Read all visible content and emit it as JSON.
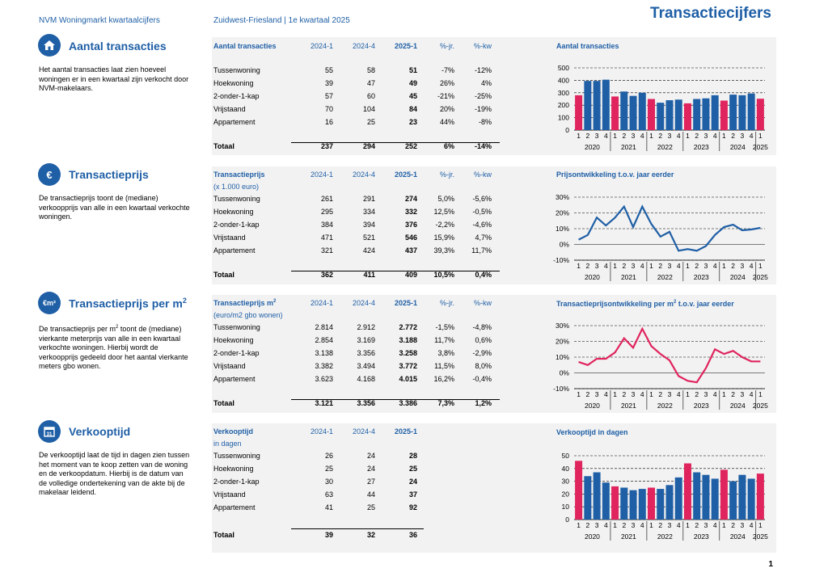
{
  "header": {
    "left": "NVM Woningmarkt kwartaalcijfers",
    "mid": "Zuidwest-Friesland | 1e kwartaal 2025",
    "title": "Transactiecijfers"
  },
  "page_number": "1",
  "colors": {
    "blue": "#1f5fa6",
    "red": "#e0245e",
    "grey_panel": "#f2f2f2"
  },
  "x_axis": {
    "quarters": [
      "1",
      "2",
      "3",
      "4",
      "1",
      "2",
      "3",
      "4",
      "1",
      "2",
      "3",
      "4",
      "1",
      "2",
      "3",
      "4",
      "1",
      "2",
      "3",
      "4",
      "1"
    ],
    "years": [
      "2020",
      "2021",
      "2022",
      "2023",
      "2024",
      "2025"
    ]
  },
  "sections": [
    {
      "icon": "house-icon",
      "title": "Aantal transacties",
      "desc": "Het aantal transacties laat zien hoeveel woningen er in een kwartaal zijn verkocht door NVM-makelaars.",
      "table": {
        "head": [
          "Aantal transacties",
          "2024-1",
          "2024-4",
          "2025-1",
          "%-jr.",
          "%-kw"
        ],
        "unit": "",
        "rows": [
          [
            "Tussenwoning",
            "55",
            "58",
            "51",
            "-7%",
            "-12%"
          ],
          [
            "Hoekwoning",
            "39",
            "47",
            "49",
            "26%",
            "4%"
          ],
          [
            "2-onder-1-kap",
            "57",
            "60",
            "45",
            "-21%",
            "-25%"
          ],
          [
            "Vrijstaand",
            "70",
            "104",
            "84",
            "20%",
            "-19%"
          ],
          [
            "Appartement",
            "16",
            "25",
            "23",
            "44%",
            "-8%"
          ]
        ],
        "total": [
          "Totaal",
          "237",
          "294",
          "252",
          "6%",
          "-14%"
        ]
      }
    },
    {
      "icon": "euro-icon",
      "title": "Transactieprijs",
      "desc": "De transactieprijs toont de (mediane) verkoopprijs van alle in een kwartaal verkochte woningen.",
      "table": {
        "head": [
          "Transactieprijs",
          "2024-1",
          "2024-4",
          "2025-1",
          "%-jr.",
          "%-kw"
        ],
        "unit": "(x 1.000 euro)",
        "rows": [
          [
            "Tussenwoning",
            "261",
            "291",
            "274",
            "5,0%",
            "-5,6%"
          ],
          [
            "Hoekwoning",
            "295",
            "334",
            "332",
            "12,5%",
            "-0,5%"
          ],
          [
            "2-onder-1-kap",
            "384",
            "394",
            "376",
            "-2,2%",
            "-4,6%"
          ],
          [
            "Vrijstaand",
            "471",
            "521",
            "546",
            "15,9%",
            "4,7%"
          ],
          [
            "Appartement",
            "321",
            "424",
            "437",
            "39,3%",
            "11,7%"
          ]
        ],
        "total": [
          "Totaal",
          "362",
          "411",
          "409",
          "10,5%",
          "0,4%"
        ]
      }
    },
    {
      "icon": "euro-m2-icon",
      "title": "Transactieprijs per m",
      "title_sup": "2",
      "desc_a": "De transactieprijs per m",
      "desc_sup": "2",
      "desc_b": " toont de (mediane) vierkante meterprijs van alle in een kwartaal verkochte woningen. Hierbij wordt de verkoopprijs gedeeld door het aantal vierkante meters gbo wonen.",
      "table": {
        "head": [
          "Transactieprijs m",
          "2024-1",
          "2024-4",
          "2025-1",
          "%-jr.",
          "%-kw"
        ],
        "head_sup": "2",
        "unit": "(euro/m2 gbo wonen)",
        "rows": [
          [
            "Tussenwoning",
            "2.814",
            "2.912",
            "2.772",
            "-1,5%",
            "-4,8%"
          ],
          [
            "Hoekwoning",
            "2.854",
            "3.169",
            "3.188",
            "11,7%",
            "0,6%"
          ],
          [
            "2-onder-1-kap",
            "3.138",
            "3.356",
            "3.258",
            "3,8%",
            "-2,9%"
          ],
          [
            "Vrijstaand",
            "3.382",
            "3.494",
            "3.772",
            "11,5%",
            "8,0%"
          ],
          [
            "Appartement",
            "3.623",
            "4.168",
            "4.015",
            "16,2%",
            "-0,4%"
          ]
        ],
        "total": [
          "Totaal",
          "3.121",
          "3.356",
          "3.386",
          "7,3%",
          "1,2%"
        ]
      }
    },
    {
      "icon": "calendar-icon",
      "title": "Verkooptijd",
      "desc": "De verkooptijd laat de tijd in dagen zien tussen het moment van te koop zetten van de woning en de verkoopdatum. Hierbij is de datum van de volledige ondertekening van de akte bij de makelaar leidend.",
      "table": {
        "head": [
          "Verkooptijd",
          "2024-1",
          "2024-4",
          "2025-1",
          "",
          ""
        ],
        "unit": "in dagen",
        "rows": [
          [
            "Tussenwoning",
            "26",
            "24",
            "28",
            "",
            ""
          ],
          [
            "Hoekwoning",
            "25",
            "24",
            "25",
            "",
            ""
          ],
          [
            "2-onder-1-kap",
            "30",
            "27",
            "24",
            "",
            ""
          ],
          [
            "Vrijstaand",
            "63",
            "44",
            "37",
            "",
            ""
          ],
          [
            "Appartement",
            "41",
            "25",
            "92",
            "",
            ""
          ]
        ],
        "total": [
          "Totaal",
          "39",
          "32",
          "36",
          "",
          ""
        ]
      }
    }
  ],
  "chart_data": [
    {
      "type": "bar",
      "title": "Aantal transacties",
      "ylim": [
        0,
        500
      ],
      "yticks": [
        "0",
        "100",
        "200",
        "300",
        "400",
        "500"
      ],
      "highlight": "first quarter in red",
      "values": [
        280,
        395,
        395,
        405,
        270,
        310,
        275,
        300,
        250,
        220,
        240,
        245,
        215,
        250,
        255,
        280,
        237,
        285,
        280,
        294,
        252
      ]
    },
    {
      "type": "line",
      "title": "Prijsontwikkeling t.o.v. jaar eerder",
      "ylim": [
        -10,
        30
      ],
      "yticks": [
        "-10%",
        "0%",
        "10%",
        "20%",
        "30%"
      ],
      "color": "#1f5fa6",
      "values": [
        3,
        6,
        17,
        12,
        17,
        24,
        11,
        24,
        13,
        5,
        8,
        -4,
        -3,
        -4,
        -1,
        6,
        11,
        12.5,
        9,
        9.5,
        10.5
      ]
    },
    {
      "type": "line",
      "title_a": "Transactieprijsontwikkeling per m",
      "title_sup": "2",
      "title_b": " t.o.v. jaar eerder",
      "ylim": [
        -10,
        30
      ],
      "yticks": [
        "-10%",
        "0%",
        "10%",
        "20%",
        "30%"
      ],
      "color": "#e0245e",
      "values": [
        7,
        5,
        9,
        9,
        13,
        22,
        16,
        28,
        17,
        12,
        8,
        -2,
        -5,
        -6,
        3,
        15,
        12,
        14,
        10,
        7.3,
        7.3
      ]
    },
    {
      "type": "bar",
      "title": "Verkooptijd in dagen",
      "ylim": [
        0,
        50
      ],
      "yticks": [
        "0",
        "10",
        "20",
        "30",
        "40",
        "50"
      ],
      "values": [
        46,
        34,
        37,
        29,
        26,
        25,
        23,
        24,
        25,
        24,
        27,
        33,
        44,
        37,
        35,
        32,
        39,
        30,
        35,
        32,
        36
      ]
    }
  ]
}
